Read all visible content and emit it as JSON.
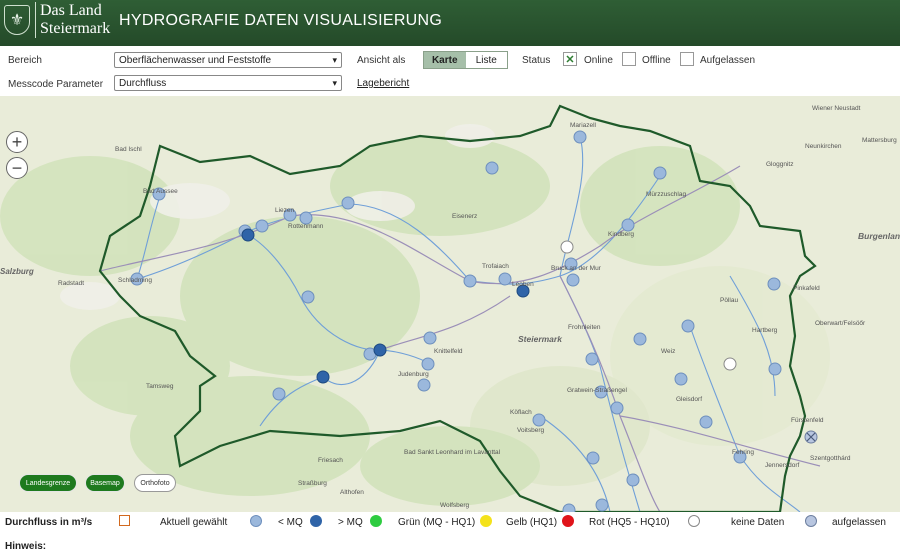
{
  "header": {
    "logo_line1": "Das Land",
    "logo_line2": "Steiermark",
    "title": "HYDROGRAFIE DATEN VISUALISIERUNG"
  },
  "controls": {
    "bereich_label": "Bereich",
    "bereich_value": "Oberflächenwasser und Feststoffe",
    "parameter_label": "Messcode Parameter",
    "parameter_value": "Durchfluss",
    "ansicht_label": "Ansicht als",
    "view_karte": "Karte",
    "view_liste": "Liste",
    "status_label": "Status",
    "status_online": "Online",
    "status_offline": "Offline",
    "status_aufgelassen": "Aufgelassen",
    "status_online_checked": true,
    "lagebericht_link": "Lagebericht"
  },
  "map": {
    "place_labels": [
      "Mariazell",
      "Wiener Neustadt",
      "Neunkirchen",
      "Gloggnitz",
      "Mürzzuschlag",
      "Kindberg",
      "Bruck an der Mur",
      "Leoben",
      "Trofaiach",
      "Eisenerz",
      "Liezen",
      "Rottenmann",
      "Bad Ischl",
      "Bad Aussee",
      "Schladming",
      "Radstadt",
      "Tamsweg",
      "Judenburg",
      "Knittelfeld",
      "Frohnleiten",
      "Steiermark",
      "Pöllau",
      "Hartberg",
      "Pinkafeld",
      "Oberwart/Felsöőr",
      "Weiz",
      "Gleisdorf",
      "Fürstenfeld",
      "Gratwein-Straßengel",
      "Köflach",
      "Voitsberg",
      "Bad Sankt Leonhard im Lavanttal",
      "Friesach",
      "Straßburg",
      "Althofen",
      "Wolfsberg",
      "Fehring",
      "Jennersdorf",
      "Burgenland",
      "Salzburg",
      "Mattersburg",
      "Szentgotthárd"
    ],
    "zoom_in": "+",
    "zoom_out": "−",
    "btn_landesgrenze": "Landesgrenze",
    "btn_basemap": "Basemap",
    "btn_orthofoto": "Orthofoto"
  },
  "legend": {
    "title": "Durchfluss in m³/s",
    "aktuell": "Aktuell gewählt",
    "lt_mq": "< MQ",
    "gt_mq": "> MQ",
    "gruen": "Grün (MQ - HQ1)",
    "gelb": "Gelb (HQ1)",
    "rot": "Rot (HQ5 - HQ10)",
    "keine": "keine Daten",
    "aufgelassen": "aufgelassen"
  },
  "colors": {
    "header": "#2f5e35",
    "lt_mq": "#9bb8dc",
    "gt_mq": "#2f64a8",
    "gruen": "#2ecc40",
    "gelb": "#f4e21a",
    "rot": "#e0141a",
    "border": "#1f5a2a"
  },
  "hinweis": "Hinweis:"
}
